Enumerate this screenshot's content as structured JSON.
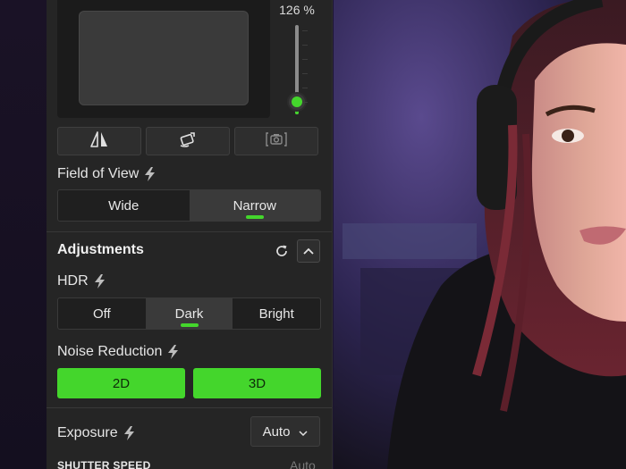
{
  "zoom": {
    "label": "126 %",
    "level_fraction": 0.14
  },
  "icon_buttons": [
    {
      "icon": "flip-horizontal-icon",
      "enabled": true
    },
    {
      "icon": "rotate-icon",
      "enabled": true
    },
    {
      "icon": "camera-frame-icon",
      "enabled": false
    }
  ],
  "field_of_view": {
    "label": "Field of View",
    "options": [
      "Wide",
      "Narrow"
    ],
    "selected": "Narrow"
  },
  "adjustments": {
    "title": "Adjustments",
    "hdr": {
      "label": "HDR",
      "options": [
        "Off",
        "Dark",
        "Bright"
      ],
      "selected": "Dark"
    },
    "noise_reduction": {
      "label": "Noise Reduction",
      "options": [
        "2D",
        "3D"
      ]
    },
    "exposure": {
      "label": "Exposure",
      "value": "Auto"
    },
    "shutter_speed": {
      "label": "SHUTTER SPEED",
      "value": "Auto"
    }
  },
  "colors": {
    "accent": "#44d62c",
    "panel_bg": "#252525"
  }
}
